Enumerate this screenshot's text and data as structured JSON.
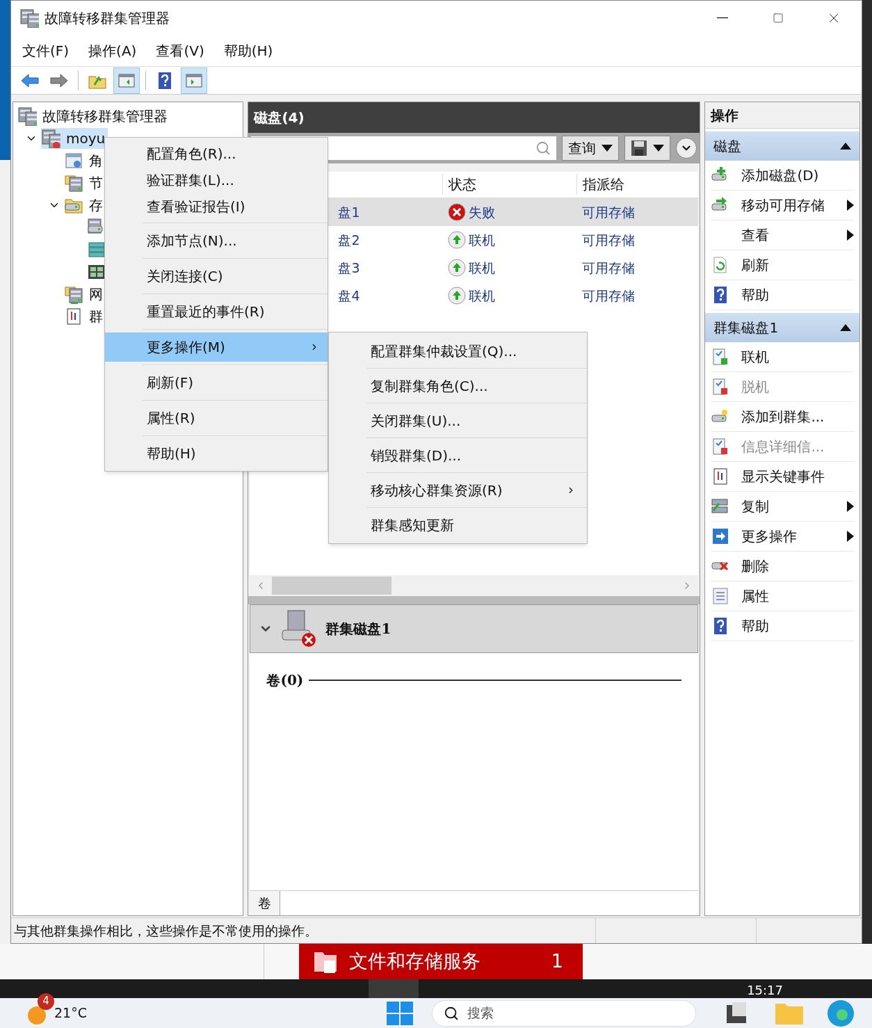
{
  "window": {
    "title": "故障转移群集管理器"
  },
  "menu_bar": [
    "文件(F)",
    "操作(A)",
    "查看(V)",
    "帮助(H)"
  ],
  "toolbar": [
    {
      "kind": "back",
      "selected": false
    },
    {
      "kind": "forward",
      "selected": false
    },
    {
      "kind": "sep"
    },
    {
      "kind": "up",
      "selected": false
    },
    {
      "kind": "tree-pane",
      "selected": true
    },
    {
      "kind": "sep"
    },
    {
      "kind": "help",
      "selected": false
    },
    {
      "kind": "action-pane",
      "selected": true
    }
  ],
  "tree": {
    "label": "故障转移群集管理器",
    "kind": "cluster",
    "children": [
      {
        "label": "moyu",
        "kind": "cluster-node",
        "selected": true,
        "expanded": true,
        "children": [
          {
            "label": "角",
            "kind": "roles"
          },
          {
            "label": "节",
            "kind": "nodes"
          },
          {
            "label": "存",
            "kind": "storage",
            "expanded": true,
            "children": [
              {
                "kind": "disks"
              },
              {
                "kind": "pools"
              },
              {
                "kind": "enclosures"
              }
            ]
          },
          {
            "label": "网",
            "kind": "network"
          },
          {
            "label": "群",
            "kind": "events"
          }
        ]
      }
    ]
  },
  "center": {
    "title": "磁盘(4)",
    "query_button": "查询",
    "columns": [
      "状态",
      "指派给"
    ],
    "rows": [
      {
        "name": "盘1",
        "status": "失败",
        "kind": "failed",
        "assigned": "可用存储",
        "selected": true
      },
      {
        "name": "盘2",
        "status": "联机",
        "kind": "online",
        "assigned": "可用存储",
        "selected": false
      },
      {
        "name": "盘3",
        "status": "联机",
        "kind": "online",
        "assigned": "可用存储",
        "selected": false
      },
      {
        "name": "盘4",
        "status": "联机",
        "kind": "online",
        "assigned": "可用存储",
        "selected": false
      }
    ],
    "detail": {
      "title": "群集磁盘1",
      "section": "卷(0)",
      "tab": "卷"
    }
  },
  "context_menu": {
    "groups": [
      [
        {
          "label": "配置角色(R)...",
          "selected": false,
          "submenu": false
        },
        {
          "label": "验证群集(L)...",
          "selected": false,
          "submenu": false
        },
        {
          "label": "查看验证报告(I)",
          "selected": false,
          "submenu": false
        }
      ],
      [
        {
          "label": "添加节点(N)...",
          "selected": false,
          "submenu": false
        }
      ],
      [
        {
          "label": "关闭连接(C)",
          "selected": false,
          "submenu": false
        }
      ],
      [
        {
          "label": "重置最近的事件(R)",
          "selected": false,
          "submenu": false
        }
      ],
      [
        {
          "label": "更多操作(M)",
          "selected": true,
          "submenu": true
        }
      ],
      [
        {
          "label": "刷新(F)",
          "selected": false,
          "submenu": false
        }
      ],
      [
        {
          "label": "属性(R)",
          "selected": false,
          "submenu": false
        }
      ],
      [
        {
          "label": "帮助(H)",
          "selected": false,
          "submenu": false
        }
      ]
    ],
    "submenu": [
      {
        "label": "配置群集仲裁设置(Q)...",
        "submenu": false
      },
      {
        "label": "复制群集角色(C)...",
        "submenu": false
      },
      {
        "label": "关闭群集(U)...",
        "submenu": false
      },
      {
        "label": "销毁群集(D)...",
        "submenu": false
      },
      {
        "label": "移动核心群集资源(R)",
        "submenu": true
      },
      {
        "label": "群集感知更新",
        "submenu": false
      }
    ]
  },
  "actions": {
    "title": "操作",
    "sections": [
      {
        "title": "磁盘",
        "expanded": true,
        "items": [
          {
            "label": "添加磁盘(D)",
            "kind": "add-disk",
            "disabled": false,
            "submenu": false
          },
          {
            "label": "移动可用存储",
            "kind": "move-disk",
            "disabled": false,
            "submenu": true
          },
          {
            "label": "查看",
            "kind": "none",
            "disabled": false,
            "submenu": true
          },
          {
            "label": "刷新",
            "kind": "refresh",
            "disabled": false,
            "submenu": false
          },
          {
            "label": "帮助",
            "kind": "help",
            "disabled": false,
            "submenu": false
          }
        ]
      },
      {
        "title": "群集磁盘1",
        "expanded": true,
        "items": [
          {
            "label": "联机",
            "kind": "online",
            "disabled": false,
            "submenu": false
          },
          {
            "label": "脱机",
            "kind": "offline",
            "disabled": true,
            "submenu": false
          },
          {
            "label": "添加到群集...",
            "kind": "add-cluster",
            "disabled": false,
            "submenu": false
          },
          {
            "label": "信息详细信...",
            "kind": "info",
            "disabled": true,
            "submenu": false
          },
          {
            "label": "显示关键事件",
            "kind": "events",
            "disabled": false,
            "submenu": false
          },
          {
            "label": "复制",
            "kind": "replicate",
            "disabled": false,
            "submenu": true
          },
          {
            "label": "更多操作",
            "kind": "more",
            "disabled": false,
            "submenu": true
          },
          {
            "label": "删除",
            "kind": "delete",
            "disabled": false,
            "submenu": false
          },
          {
            "label": "属性",
            "kind": "properties",
            "disabled": false,
            "submenu": false
          },
          {
            "label": "帮助",
            "kind": "help",
            "disabled": false,
            "submenu": false
          }
        ]
      }
    ]
  },
  "status_bar": "与其他群集操作相比，这些操作是不常使用的操作。",
  "notification": {
    "label": "文件和存储服务",
    "count": "1"
  },
  "clock": "15:17",
  "taskbar": {
    "weather": "21°C",
    "badge": "4",
    "search": "搜索"
  }
}
